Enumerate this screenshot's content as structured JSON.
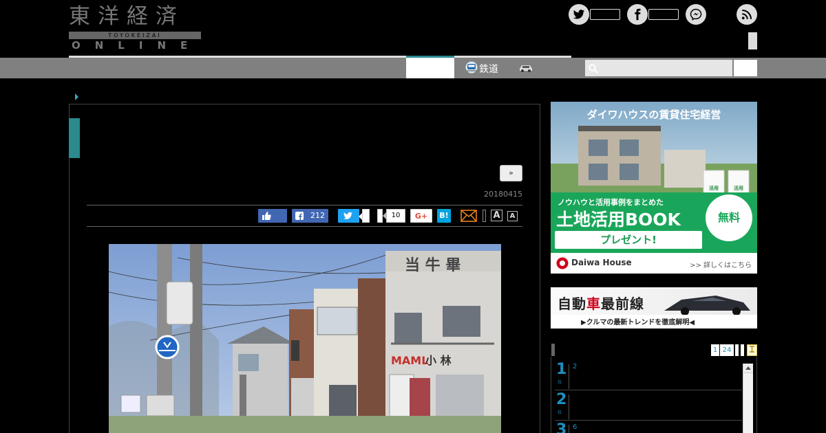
{
  "header": {
    "logo_kanji": "東洋経済",
    "logo_romaji": "TOYOKEIZAI",
    "logo_online": "ONLINE"
  },
  "icons": {
    "twitter": "twitter-icon",
    "facebook": "facebook-icon",
    "messenger": "messenger-icon",
    "rss": "rss-icon",
    "search": "search-icon",
    "mail": "mail-icon",
    "car": "car-icon",
    "train": "train-icon"
  },
  "nav": {
    "rail_label": "鉄道"
  },
  "article": {
    "next_label": "»",
    "date": "20180415",
    "share": {
      "facebook_count": "212",
      "gplus_label": "G+",
      "hatena_label": "B!",
      "hatena_count": "10",
      "font_large": "A",
      "font_small": "A"
    }
  },
  "ads": {
    "daiwa": {
      "headline": "ダイワハウスの賃貸住宅経営",
      "lead": "ノウハウと活用事例をまとめた",
      "title": "土地活用BOOK",
      "cta": "プレゼント!",
      "badge": "無料",
      "brand": "Daiwa House",
      "more": ">> 詳しくはこちら"
    },
    "car": {
      "title_1": "自動",
      "title_2": "車",
      "title_3": "最前線",
      "tagline": "▶クルマの最新トレンドを徹底解明◀"
    }
  },
  "ranking": {
    "tabs": [
      "1",
      "24"
    ],
    "rows": [
      {
        "rank": "1",
        "sub": "位",
        "text": "2"
      },
      {
        "rank": "2",
        "sub": "位",
        "text": ""
      },
      {
        "rank": "3",
        "sub": "位",
        "text": "6"
      }
    ]
  },
  "colors": {
    "accent_teal": "#2b8a8e",
    "link_blue": "#1d8fbf",
    "facebook": "#4267b2",
    "twitter": "#1da1f2",
    "daiwa_green": "#1aa65a"
  }
}
